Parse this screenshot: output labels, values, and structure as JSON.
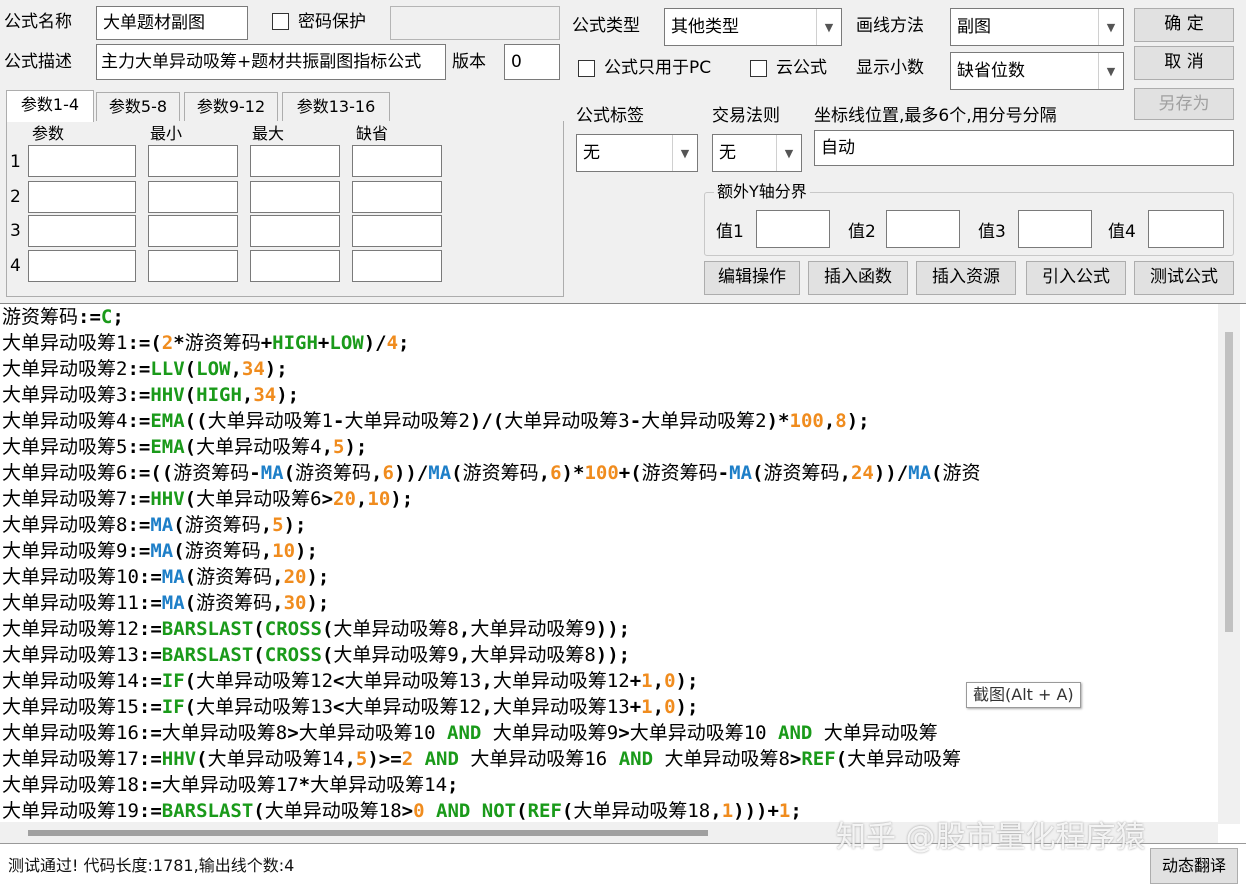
{
  "header": {
    "formula_name_label": "公式名称",
    "formula_name_value": "大单题材副图",
    "password_label": "密码保护",
    "formula_desc_label": "公式描述",
    "formula_desc_value": "主力大单异动吸筹+题材共振副图指标公式",
    "version_label": "版本",
    "version_value": "0",
    "formula_type_label": "公式类型",
    "formula_type_value": "其他类型",
    "draw_method_label": "画线方法",
    "draw_method_value": "副图",
    "pc_only_label": "公式只用于PC",
    "cloud_label": "云公式",
    "decimals_label": "显示小数",
    "decimals_value": "缺省位数",
    "ok_label": "确  定",
    "cancel_label": "取  消",
    "save_as_label": "另存为"
  },
  "params": {
    "tabs": [
      "参数1-4",
      "参数5-8",
      "参数9-12",
      "参数13-16"
    ],
    "columns": [
      "参数",
      "最小",
      "最大",
      "缺省"
    ],
    "rows": [
      "1",
      "2",
      "3",
      "4"
    ]
  },
  "right_panel": {
    "formula_tag_label": "公式标签",
    "formula_tag_value": "无",
    "trade_rule_label": "交易法则",
    "trade_rule_value": "无",
    "axis_label": "坐标线位置,最多6个,用分号分隔",
    "axis_value": "自动",
    "extra_y_label": "额外Y轴分界",
    "value_labels": [
      "值1",
      "值2",
      "值3",
      "值4"
    ],
    "buttons": [
      "编辑操作",
      "插入函数",
      "插入资源",
      "引入公式",
      "测试公式"
    ]
  },
  "editor": {
    "lines": [
      "游资筹码:=C;",
      "大单异动吸筹1:=(2*游资筹码+HIGH+LOW)/4;",
      "大单异动吸筹2:=LLV(LOW,34);",
      "大单异动吸筹3:=HHV(HIGH,34);",
      "大单异动吸筹4:=EMA((大单异动吸筹1-大单异动吸筹2)/(大单异动吸筹3-大单异动吸筹2)*100,8);",
      "大单异动吸筹5:=EMA(大单异动吸筹4,5);",
      "大单异动吸筹6:=((游资筹码-MA(游资筹码,6))/MA(游资筹码,6)*100+(游资筹码-MA(游资筹码,24))/MA(游资",
      "大单异动吸筹7:=HHV(大单异动吸筹6>20,10);",
      "大单异动吸筹8:=MA(游资筹码,5);",
      "大单异动吸筹9:=MA(游资筹码,10);",
      "大单异动吸筹10:=MA(游资筹码,20);",
      "大单异动吸筹11:=MA(游资筹码,30);",
      "大单异动吸筹12:=BARSLAST(CROSS(大单异动吸筹8,大单异动吸筹9));",
      "大单异动吸筹13:=BARSLAST(CROSS(大单异动吸筹9,大单异动吸筹8));",
      "大单异动吸筹14:=IF(大单异动吸筹12<大单异动吸筹13,大单异动吸筹12+1,0);",
      "大单异动吸筹15:=IF(大单异动吸筹13<大单异动吸筹12,大单异动吸筹13+1,0);",
      "大单异动吸筹16:=大单异动吸筹8>大单异动吸筹10 AND 大单异动吸筹9>大单异动吸筹10 AND 大单异动吸筹",
      "大单异动吸筹17:=HHV(大单异动吸筹14,5)>=2 AND 大单异动吸筹16 AND 大单异动吸筹8>REF(大单异动吸筹",
      "大单异动吸筹18:=大单异动吸筹17*大单异动吸筹14;",
      "大单异动吸筹19:=BARSLAST(大单异动吸筹18>0 AND NOT(REF(大单异动吸筹18,1)))+1;"
    ],
    "screenshot_tip": "截图(Alt + A)"
  },
  "status": {
    "text": "测试通过! 代码长度:1781,输出线个数:4",
    "translate_label": "动态翻译",
    "watermark": "知乎 @股市量化程序猿"
  },
  "colors": {
    "function_green": "#1a9a1a",
    "function_blue": "#1e7fc8",
    "number_orange": "#f08c1e"
  }
}
